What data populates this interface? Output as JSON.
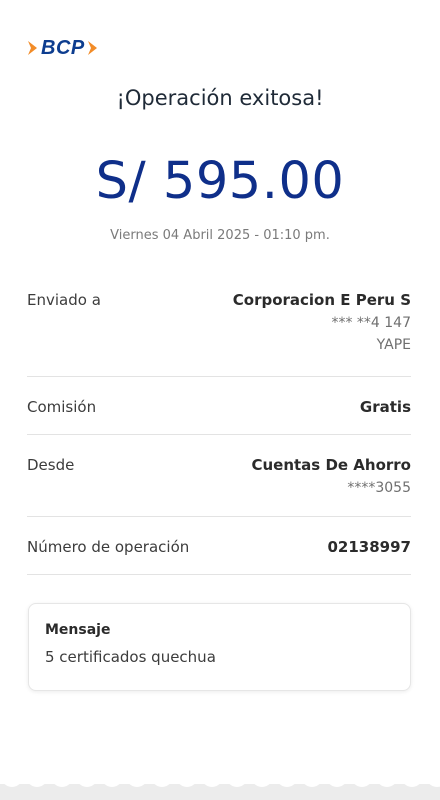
{
  "logo": {
    "text": "BCP"
  },
  "title": "¡Operación exitosa!",
  "amount": "S/ 595.00",
  "date": "Viernes 04 Abril 2025 - 01:10 pm.",
  "details": [
    {
      "label": "Enviado a",
      "main": "Corporacion E Peru S",
      "sub": [
        "*** **4 147",
        "YAPE"
      ]
    },
    {
      "label": "Comisión",
      "main": "Gratis",
      "sub": []
    },
    {
      "label": "Desde",
      "main": "Cuentas De Ahorro",
      "sub": [
        "****3055"
      ]
    },
    {
      "label": "Número de operación",
      "main": "02138997",
      "sub": []
    }
  ],
  "message": {
    "label": "Mensaje",
    "text": "5 certificados quechua"
  },
  "colors": {
    "brand_blue": "#0f2f8a",
    "brand_orange": "#f28c28",
    "background": "#ffffff"
  },
  "icons": [
    "bcp-logo-icon"
  ]
}
